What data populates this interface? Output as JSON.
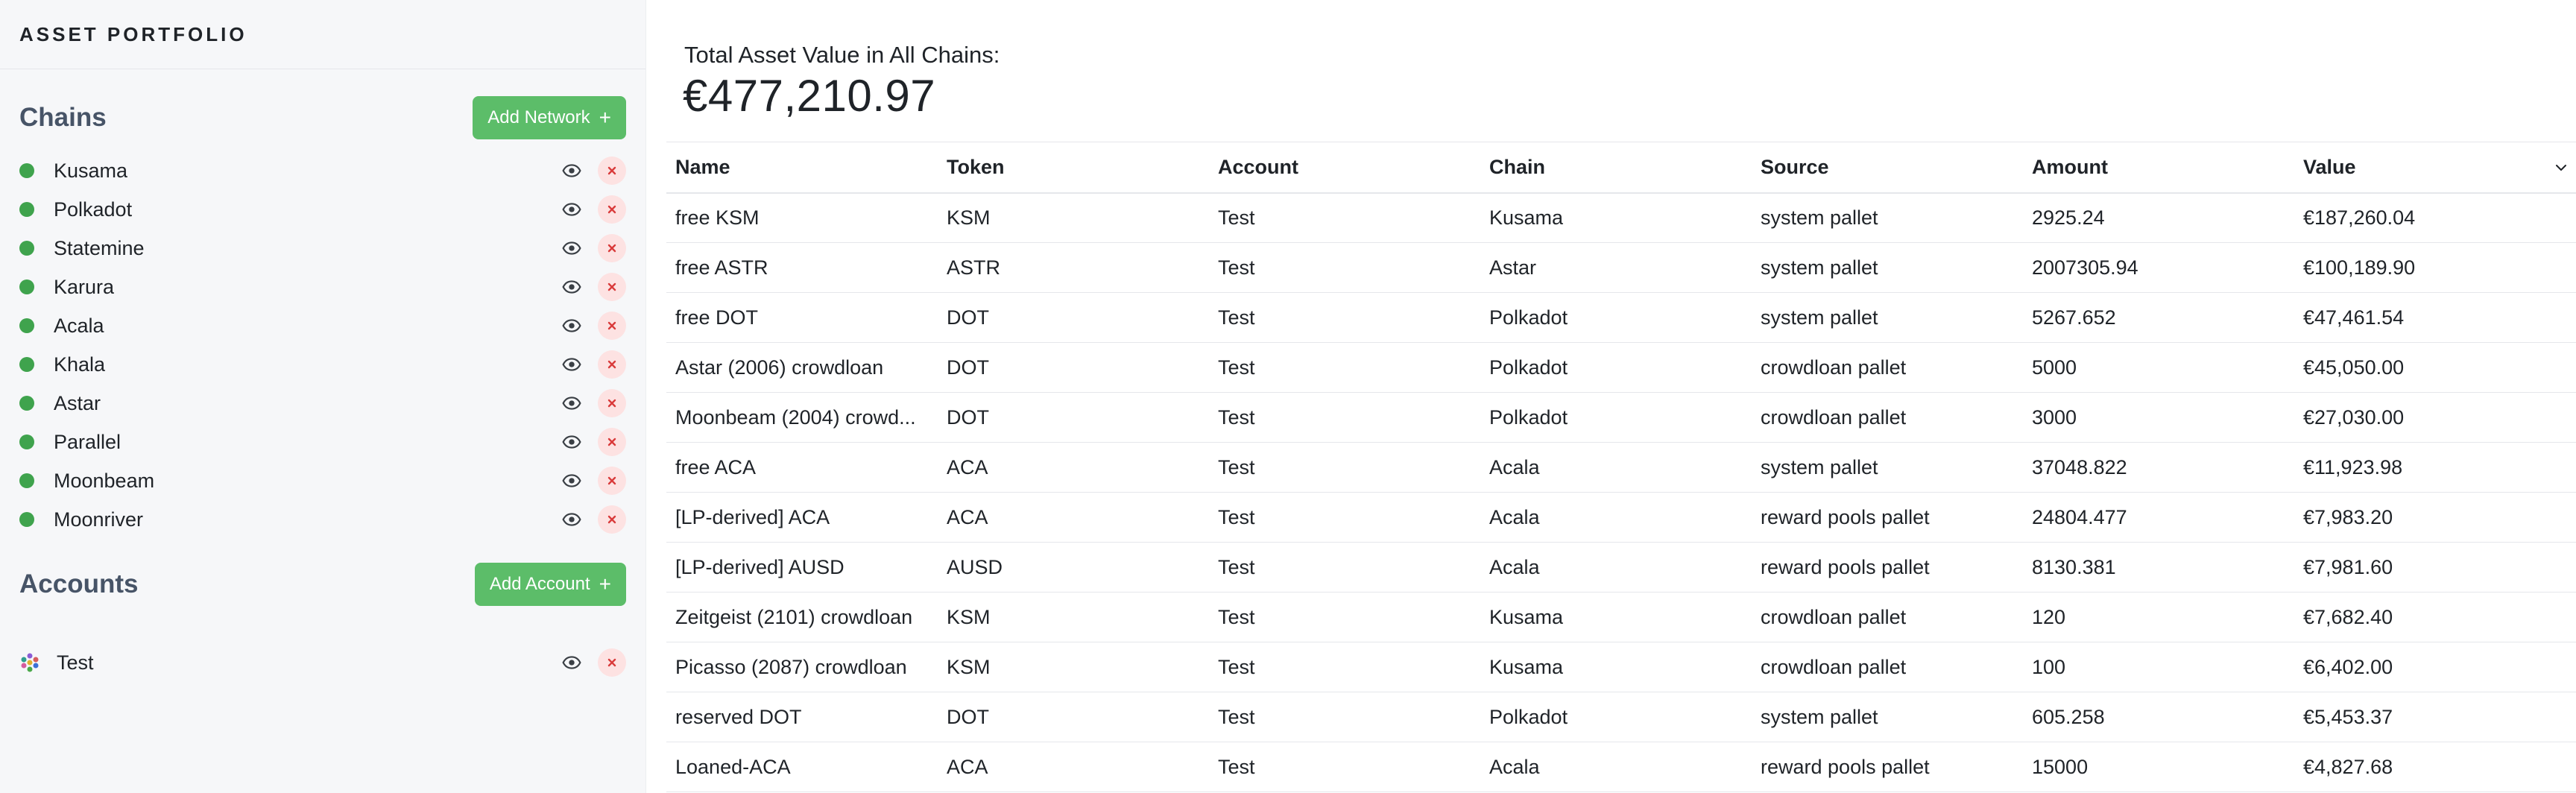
{
  "app": {
    "title": "ASSET PORTFOLIO"
  },
  "sidebar": {
    "chains_title": "Chains",
    "add_network_label": "Add Network",
    "add_network_icon": "plus-icon",
    "chains": [
      {
        "label": "Kusama",
        "status_color": "#3fa34d"
      },
      {
        "label": "Polkadot",
        "status_color": "#3fa34d"
      },
      {
        "label": "Statemine",
        "status_color": "#3fa34d"
      },
      {
        "label": "Karura",
        "status_color": "#3fa34d"
      },
      {
        "label": "Acala",
        "status_color": "#3fa34d"
      },
      {
        "label": "Khala",
        "status_color": "#3fa34d"
      },
      {
        "label": "Astar",
        "status_color": "#3fa34d"
      },
      {
        "label": "Parallel",
        "status_color": "#3fa34d"
      },
      {
        "label": "Moonbeam",
        "status_color": "#3fa34d"
      },
      {
        "label": "Moonriver",
        "status_color": "#3fa34d"
      }
    ],
    "accounts_title": "Accounts",
    "add_account_label": "Add Account",
    "accounts": [
      {
        "label": "Test",
        "icon": "identicon-avatar"
      }
    ],
    "row_icons": {
      "visibility": "eye-icon",
      "remove": "close-icon"
    }
  },
  "summary": {
    "label": "Total Asset Value in All Chains:",
    "value": "€477,210.97"
  },
  "table": {
    "headers": [
      "Name",
      "Token",
      "Account",
      "Chain",
      "Source",
      "Amount",
      "Value"
    ],
    "sort_icon": "chevron-down-icon",
    "rows": [
      [
        "free KSM",
        "KSM",
        "Test",
        "Kusama",
        "system pallet",
        "2925.24",
        "€187,260.04"
      ],
      [
        "free ASTR",
        "ASTR",
        "Test",
        "Astar",
        "system pallet",
        "2007305.94",
        "€100,189.90"
      ],
      [
        "free DOT",
        "DOT",
        "Test",
        "Polkadot",
        "system pallet",
        "5267.652",
        "€47,461.54"
      ],
      [
        "Astar (2006) crowdloan",
        "DOT",
        "Test",
        "Polkadot",
        "crowdloan pallet",
        "5000",
        "€45,050.00"
      ],
      [
        "Moonbeam (2004) crowd...",
        "DOT",
        "Test",
        "Polkadot",
        "crowdloan pallet",
        "3000",
        "€27,030.00"
      ],
      [
        "free ACA",
        "ACA",
        "Test",
        "Acala",
        "system pallet",
        "37048.822",
        "€11,923.98"
      ],
      [
        "[LP-derived] ACA",
        "ACA",
        "Test",
        "Acala",
        "reward pools pallet",
        "24804.477",
        "€7,983.20"
      ],
      [
        "[LP-derived] AUSD",
        "AUSD",
        "Test",
        "Acala",
        "reward pools pallet",
        "8130.381",
        "€7,981.60"
      ],
      [
        "Zeitgeist (2101) crowdloan",
        "KSM",
        "Test",
        "Kusama",
        "crowdloan pallet",
        "120",
        "€7,682.40"
      ],
      [
        "Picasso (2087) crowdloan",
        "KSM",
        "Test",
        "Kusama",
        "crowdloan pallet",
        "100",
        "€6,402.00"
      ],
      [
        "reserved DOT",
        "DOT",
        "Test",
        "Polkadot",
        "system pallet",
        "605.258",
        "€5,453.37"
      ],
      [
        "Loaned-ACA",
        "ACA",
        "Test",
        "Acala",
        "reward pools pallet",
        "15000",
        "€4,827.68"
      ]
    ]
  },
  "colors": {
    "accent_green": "#5cbd69",
    "status_dot": "#3fa34d",
    "remove_bg": "#fde2e2",
    "remove_fg": "#d93b3b"
  }
}
